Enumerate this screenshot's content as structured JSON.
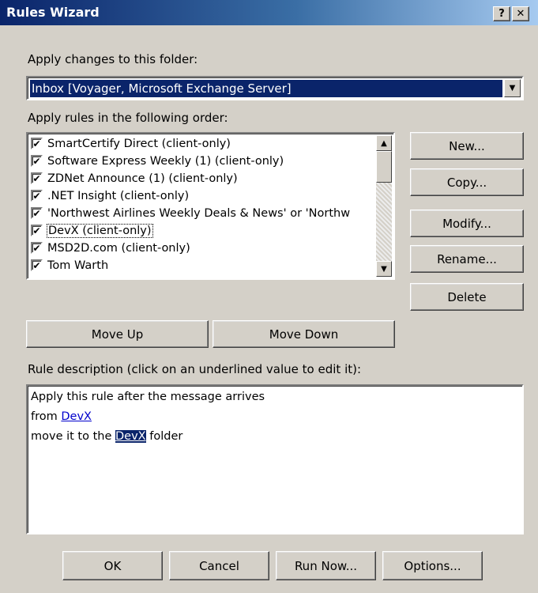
{
  "window": {
    "title": "Rules Wizard",
    "help_label": "?",
    "close_label": "✕"
  },
  "folder": {
    "label": "Apply changes to this folder:",
    "selected": "Inbox [Voyager, Microsoft Exchange Server]"
  },
  "rules": {
    "label": "Apply rules in the following order:",
    "items": [
      {
        "label": "SmartCertify Direct  (client-only)",
        "checked": true
      },
      {
        "label": "Software Express Weekly (1)  (client-only)",
        "checked": true
      },
      {
        "label": "ZDNet Announce (1)  (client-only)",
        "checked": true
      },
      {
        "label": ".NET Insight  (client-only)",
        "checked": true
      },
      {
        "label": "'Northwest Airlines Weekly Deals & News' or 'Northw",
        "checked": true
      },
      {
        "label": "DevX  (client-only)",
        "checked": true,
        "focused": true
      },
      {
        "label": "MSD2D.com  (client-only)",
        "checked": true
      },
      {
        "label": "Tom Warth",
        "checked": true
      }
    ]
  },
  "side_buttons": {
    "new": "New...",
    "copy": "Copy...",
    "modify": "Modify...",
    "rename": "Rename...",
    "delete": "Delete"
  },
  "order_buttons": {
    "move_up": "Move Up",
    "move_down": "Move Down"
  },
  "description": {
    "label": "Rule description (click on an underlined value to edit it):",
    "line1": "Apply this rule after the message arrives",
    "line2_prefix": "from ",
    "line2_link": "DevX",
    "line3_prefix": "move it to the ",
    "line3_link": "DevX",
    "line3_suffix": " folder"
  },
  "footer_buttons": {
    "ok": "OK",
    "cancel": "Cancel",
    "run_now": "Run Now...",
    "options": "Options..."
  }
}
